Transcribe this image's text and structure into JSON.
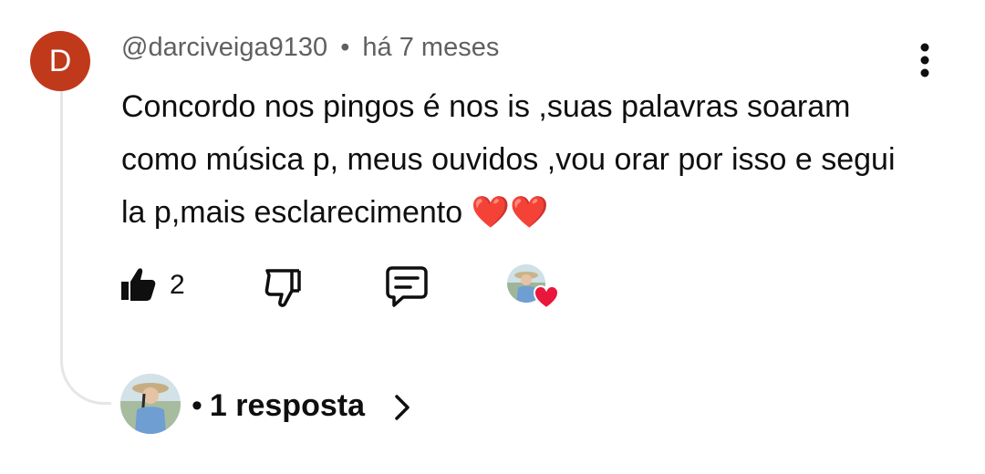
{
  "comment": {
    "avatar_letter": "D",
    "avatar_color": "#c0391b",
    "author": "@darciveiga9130",
    "separator": "•",
    "time_ago": "há 7 meses",
    "text": "Concordo nos pingos é nos is ,suas palavras soaram como música p, meus ouvidos ,vou orar por isso e segui la p,mais esclarecimento",
    "emoji": "❤️❤️"
  },
  "actions": {
    "like_icon": "thumbs-up-icon",
    "like_count": "2",
    "dislike_icon": "thumbs-down-icon",
    "reply_icon": "comment-icon",
    "creator_heart_icon": "heart-icon",
    "menu_icon": "more-vert-icon"
  },
  "replies": {
    "bullet": "•",
    "label": "1 resposta",
    "chevron_icon": "chevron-right-icon"
  },
  "colors": {
    "text": "#0f0f0f",
    "secondary_text": "#606060",
    "heart": "#e02c2c",
    "thread_line": "#e6e6e6"
  }
}
